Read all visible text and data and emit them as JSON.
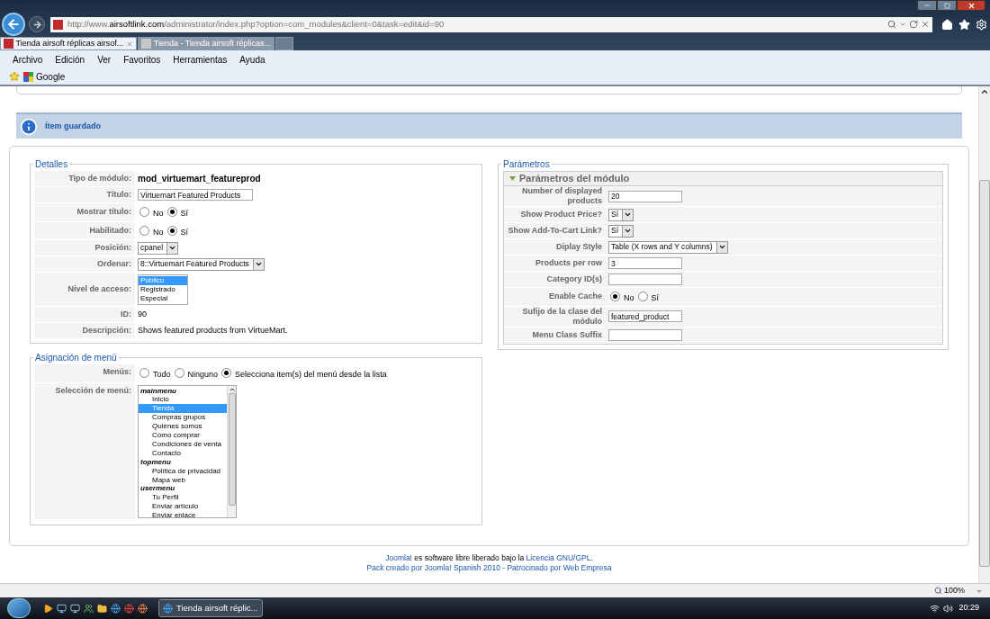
{
  "browser": {
    "url_prefix": "http://www.",
    "url_domain": "airsoftlink.com",
    "url_path": "/administrator/index.php?option=com_modules&client=0&task=edit&id=90",
    "tabs": [
      {
        "label": "Tienda airsoft réplicas airsof...",
        "selected": true
      },
      {
        "label": "Tienda - Tienda airsoft réplicas...",
        "selected": false
      }
    ],
    "menu": [
      "Archivo",
      "Edición",
      "Ver",
      "Favoritos",
      "Herramientas",
      "Ayuda"
    ],
    "favorites": [
      "Google"
    ]
  },
  "message": "Ítem guardado",
  "details": {
    "legend": "Detalles",
    "rows": [
      {
        "label": "Tipo de módulo:",
        "kind": "strong",
        "value": "mod_virtuemart_featureprod"
      },
      {
        "label": "Título:",
        "kind": "input",
        "value": "Virtuemart Featured Products"
      },
      {
        "label": "Mostrar título:",
        "kind": "radio",
        "options": [
          {
            "label": "No",
            "selected": false
          },
          {
            "label": "Sí",
            "selected": true
          }
        ]
      },
      {
        "label": "Habilitado:",
        "kind": "radio",
        "options": [
          {
            "label": "No",
            "selected": false
          },
          {
            "label": "Sí",
            "selected": true
          }
        ]
      },
      {
        "label": "Posición:",
        "kind": "select",
        "value": "cpanel"
      },
      {
        "label": "Ordenar:",
        "kind": "select",
        "value": "8::Virtuemart Featured Products"
      },
      {
        "label": "Nivel de acceso:",
        "kind": "listbox",
        "options": [
          {
            "label": "Público",
            "selected": true
          },
          {
            "label": "Registrado",
            "selected": false
          },
          {
            "label": "Especial",
            "selected": false
          }
        ]
      },
      {
        "label": "ID:",
        "kind": "text",
        "value": "90"
      },
      {
        "label": "Descripción:",
        "kind": "text",
        "value": "Shows featured products from VirtueMart."
      }
    ]
  },
  "menu_assignment": {
    "legend": "Asignación de menú",
    "rows": [
      {
        "label": "Menús:",
        "kind": "radio",
        "options": [
          {
            "label": "Todo",
            "selected": false
          },
          {
            "label": "Ninguno",
            "selected": false
          },
          {
            "label": "Selecciona item(s) del menú desde la lista",
            "selected": true
          }
        ]
      },
      {
        "label": "Selección de menú:",
        "kind": "menulist",
        "groups": [
          {
            "name": "mainmenu",
            "children": [
              {
                "label": "Inicio",
                "selected": false
              },
              {
                "label": "Tienda",
                "selected": true
              },
              {
                "label": "Compras grupos",
                "selected": false
              },
              {
                "label": "Quiénes somos",
                "selected": false
              },
              {
                "label": "Cómo comprar",
                "selected": false
              },
              {
                "label": "Condiciones de venta",
                "selected": false
              },
              {
                "label": "Contacto",
                "selected": false
              }
            ]
          },
          {
            "name": "topmenu",
            "children": [
              {
                "label": "Política de privacidad",
                "selected": false
              },
              {
                "label": "Mapa web",
                "selected": false
              }
            ]
          },
          {
            "name": "usermenu",
            "children": [
              {
                "label": "Tu Perfil",
                "selected": false
              },
              {
                "label": "Enviar artículo",
                "selected": false
              },
              {
                "label": "Enviar enlace",
                "selected": false
              }
            ]
          }
        ]
      }
    ]
  },
  "params": {
    "legend": "Parámetros",
    "panel_title": "Parámetros del módulo",
    "expanded": true,
    "rows": [
      {
        "label": "Number of displayed products",
        "kind": "input",
        "value": "20"
      },
      {
        "label": "Show Product Price?",
        "kind": "select",
        "value": "Sí"
      },
      {
        "label": "Show Add-To-Cart Link?",
        "kind": "select",
        "value": "Sí"
      },
      {
        "label": "Diplay Style",
        "kind": "select",
        "value": "Table (X rows and Y columns)"
      },
      {
        "label": "Products per row",
        "kind": "input",
        "value": "3"
      },
      {
        "label": "Category ID(s)",
        "kind": "input"
      },
      {
        "label": "Enable Cache",
        "kind": "radio",
        "options": [
          {
            "label": "No",
            "selected": true
          },
          {
            "label": "Sí",
            "selected": false
          }
        ]
      },
      {
        "label": "Sufijo de la clase del módulo",
        "kind": "input",
        "value": "featured_product"
      },
      {
        "label": "Menu Class Suffix",
        "kind": "input"
      }
    ]
  },
  "footer": {
    "line1": [
      {
        "text": "Joomla!",
        "kind": "link"
      },
      {
        "text": " es software libre liberado bajo la ",
        "kind": "text"
      },
      {
        "text": "Licencia GNU/GPL",
        "kind": "link"
      },
      {
        "text": ".",
        "kind": "text"
      }
    ],
    "line2": "Pack creado por Joomla! Spanish 2010 - Patrocinado por Web Empresa"
  },
  "status": {
    "zoom": "100%"
  },
  "taskbar": {
    "window": "Tienda airsoft réplic...",
    "clock": "20:29"
  }
}
